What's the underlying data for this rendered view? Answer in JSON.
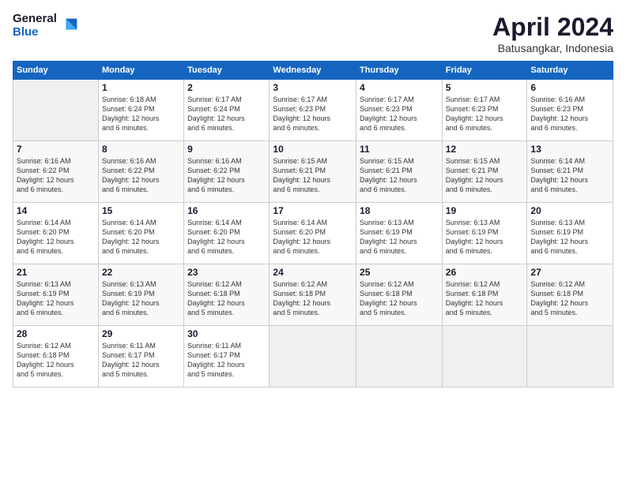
{
  "logo": {
    "general": "General",
    "blue": "Blue"
  },
  "title": "April 2024",
  "subtitle": "Batusangkar, Indonesia",
  "days_header": [
    "Sunday",
    "Monday",
    "Tuesday",
    "Wednesday",
    "Thursday",
    "Friday",
    "Saturday"
  ],
  "weeks": [
    [
      {
        "day": "",
        "info": ""
      },
      {
        "day": "1",
        "info": "Sunrise: 6:18 AM\nSunset: 6:24 PM\nDaylight: 12 hours\nand 6 minutes."
      },
      {
        "day": "2",
        "info": "Sunrise: 6:17 AM\nSunset: 6:24 PM\nDaylight: 12 hours\nand 6 minutes."
      },
      {
        "day": "3",
        "info": "Sunrise: 6:17 AM\nSunset: 6:23 PM\nDaylight: 12 hours\nand 6 minutes."
      },
      {
        "day": "4",
        "info": "Sunrise: 6:17 AM\nSunset: 6:23 PM\nDaylight: 12 hours\nand 6 minutes."
      },
      {
        "day": "5",
        "info": "Sunrise: 6:17 AM\nSunset: 6:23 PM\nDaylight: 12 hours\nand 6 minutes."
      },
      {
        "day": "6",
        "info": "Sunrise: 6:16 AM\nSunset: 6:23 PM\nDaylight: 12 hours\nand 6 minutes."
      }
    ],
    [
      {
        "day": "7",
        "info": "Sunrise: 6:16 AM\nSunset: 6:22 PM\nDaylight: 12 hours\nand 6 minutes."
      },
      {
        "day": "8",
        "info": "Sunrise: 6:16 AM\nSunset: 6:22 PM\nDaylight: 12 hours\nand 6 minutes."
      },
      {
        "day": "9",
        "info": "Sunrise: 6:16 AM\nSunset: 6:22 PM\nDaylight: 12 hours\nand 6 minutes."
      },
      {
        "day": "10",
        "info": "Sunrise: 6:15 AM\nSunset: 6:21 PM\nDaylight: 12 hours\nand 6 minutes."
      },
      {
        "day": "11",
        "info": "Sunrise: 6:15 AM\nSunset: 6:21 PM\nDaylight: 12 hours\nand 6 minutes."
      },
      {
        "day": "12",
        "info": "Sunrise: 6:15 AM\nSunset: 6:21 PM\nDaylight: 12 hours\nand 6 minutes."
      },
      {
        "day": "13",
        "info": "Sunrise: 6:14 AM\nSunset: 6:21 PM\nDaylight: 12 hours\nand 6 minutes."
      }
    ],
    [
      {
        "day": "14",
        "info": "Sunrise: 6:14 AM\nSunset: 6:20 PM\nDaylight: 12 hours\nand 6 minutes."
      },
      {
        "day": "15",
        "info": "Sunrise: 6:14 AM\nSunset: 6:20 PM\nDaylight: 12 hours\nand 6 minutes."
      },
      {
        "day": "16",
        "info": "Sunrise: 6:14 AM\nSunset: 6:20 PM\nDaylight: 12 hours\nand 6 minutes."
      },
      {
        "day": "17",
        "info": "Sunrise: 6:14 AM\nSunset: 6:20 PM\nDaylight: 12 hours\nand 6 minutes."
      },
      {
        "day": "18",
        "info": "Sunrise: 6:13 AM\nSunset: 6:19 PM\nDaylight: 12 hours\nand 6 minutes."
      },
      {
        "day": "19",
        "info": "Sunrise: 6:13 AM\nSunset: 6:19 PM\nDaylight: 12 hours\nand 6 minutes."
      },
      {
        "day": "20",
        "info": "Sunrise: 6:13 AM\nSunset: 6:19 PM\nDaylight: 12 hours\nand 6 minutes."
      }
    ],
    [
      {
        "day": "21",
        "info": "Sunrise: 6:13 AM\nSunset: 6:19 PM\nDaylight: 12 hours\nand 6 minutes."
      },
      {
        "day": "22",
        "info": "Sunrise: 6:13 AM\nSunset: 6:19 PM\nDaylight: 12 hours\nand 6 minutes."
      },
      {
        "day": "23",
        "info": "Sunrise: 6:12 AM\nSunset: 6:18 PM\nDaylight: 12 hours\nand 5 minutes."
      },
      {
        "day": "24",
        "info": "Sunrise: 6:12 AM\nSunset: 6:18 PM\nDaylight: 12 hours\nand 5 minutes."
      },
      {
        "day": "25",
        "info": "Sunrise: 6:12 AM\nSunset: 6:18 PM\nDaylight: 12 hours\nand 5 minutes."
      },
      {
        "day": "26",
        "info": "Sunrise: 6:12 AM\nSunset: 6:18 PM\nDaylight: 12 hours\nand 5 minutes."
      },
      {
        "day": "27",
        "info": "Sunrise: 6:12 AM\nSunset: 6:18 PM\nDaylight: 12 hours\nand 5 minutes."
      }
    ],
    [
      {
        "day": "28",
        "info": "Sunrise: 6:12 AM\nSunset: 6:18 PM\nDaylight: 12 hours\nand 5 minutes."
      },
      {
        "day": "29",
        "info": "Sunrise: 6:11 AM\nSunset: 6:17 PM\nDaylight: 12 hours\nand 5 minutes."
      },
      {
        "day": "30",
        "info": "Sunrise: 6:11 AM\nSunset: 6:17 PM\nDaylight: 12 hours\nand 5 minutes."
      },
      {
        "day": "",
        "info": ""
      },
      {
        "day": "",
        "info": ""
      },
      {
        "day": "",
        "info": ""
      },
      {
        "day": "",
        "info": ""
      }
    ]
  ]
}
